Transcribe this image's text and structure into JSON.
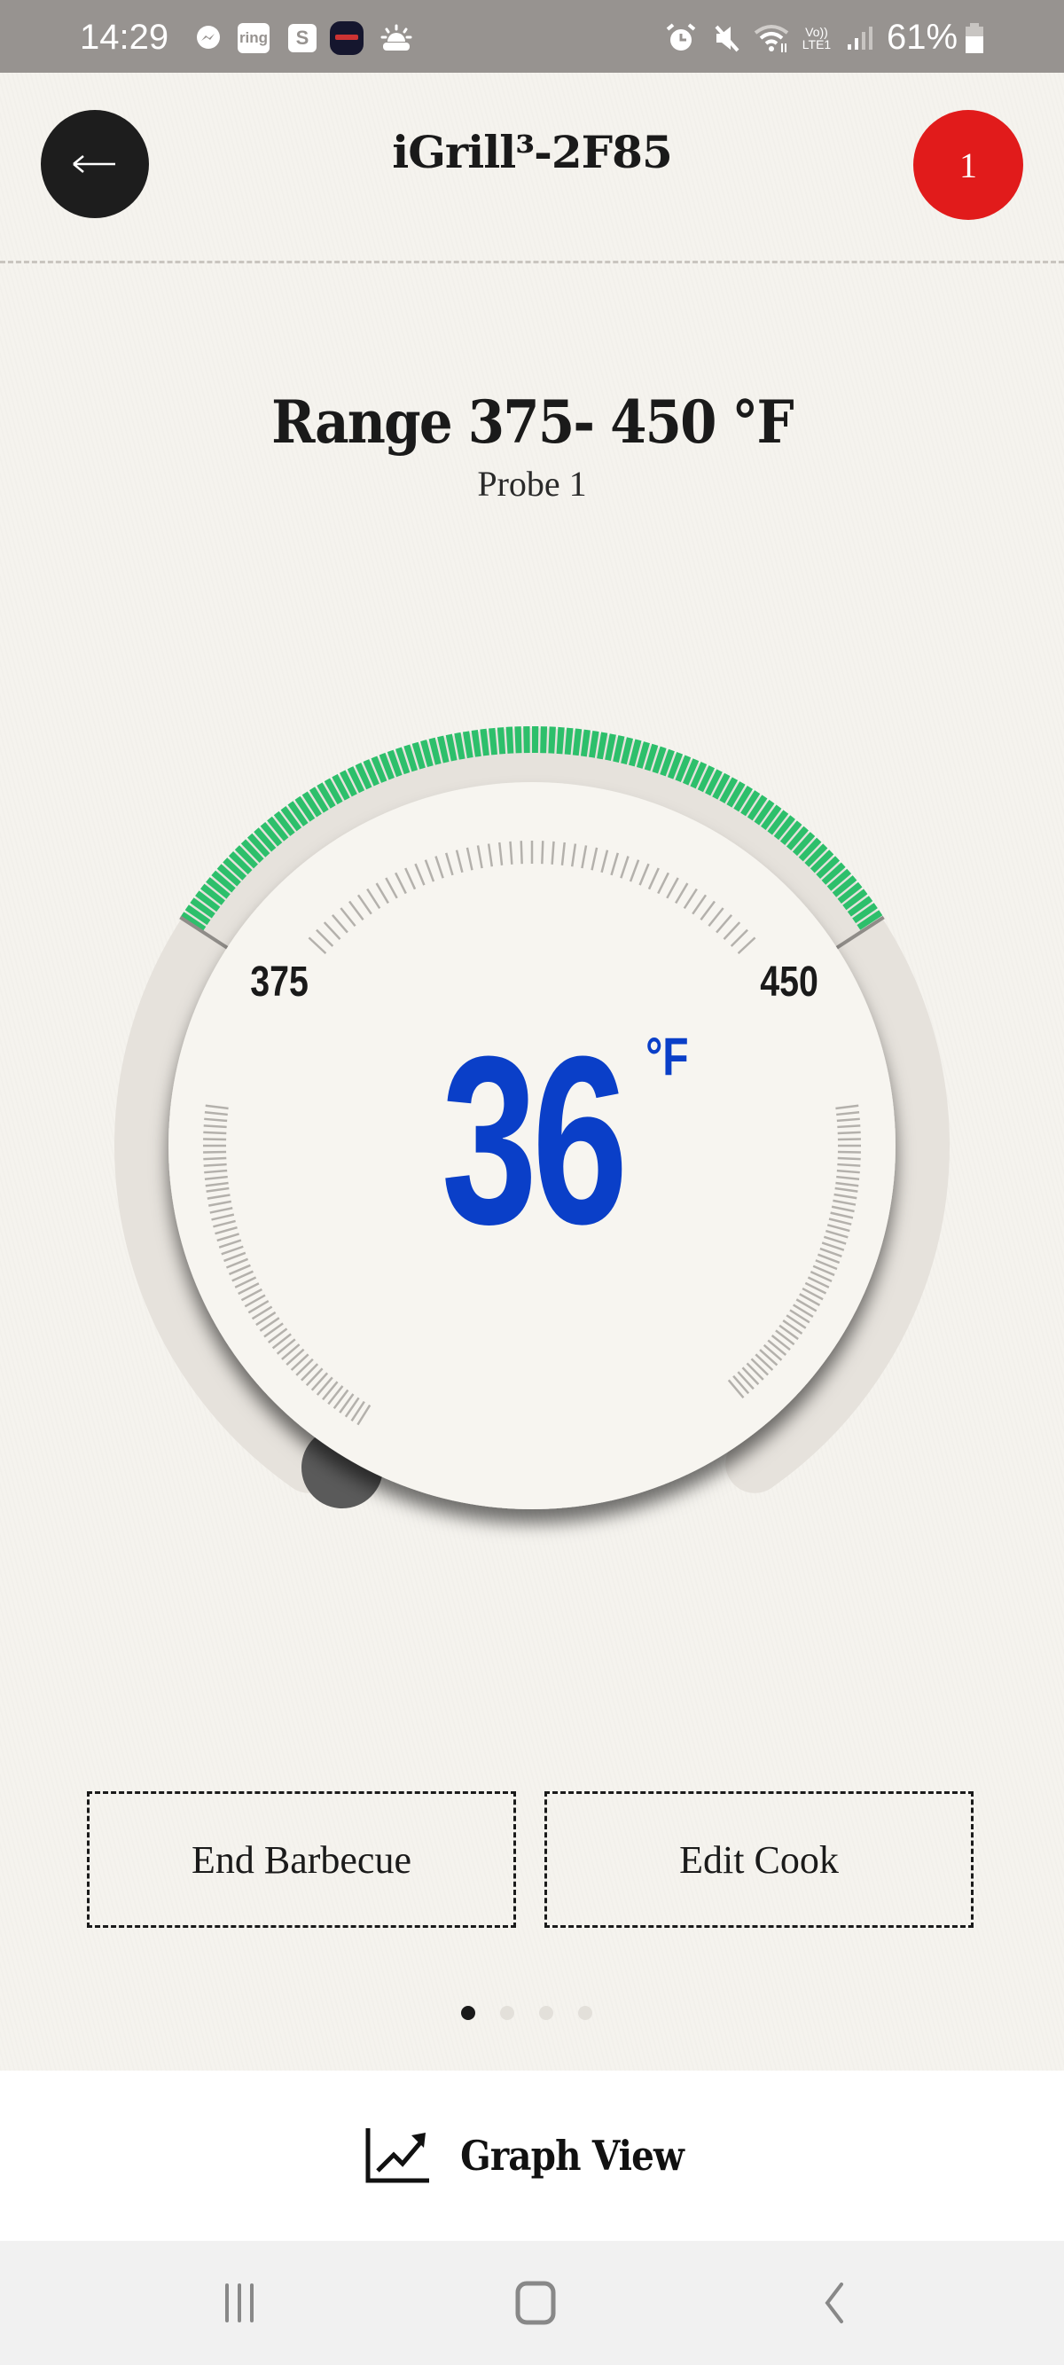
{
  "status_bar": {
    "time": "14:29",
    "left_icons": [
      "messenger-icon",
      "ring-icon",
      "s-app-icon",
      "app-badge-icon",
      "weather-sunrise-icon"
    ],
    "ring_label": "ring",
    "s_label": "S",
    "right_icons": [
      "alarm-icon",
      "mute-icon",
      "wifi-icon",
      "volte-lte-icon",
      "signal-icon",
      "battery-icon"
    ],
    "volte_label": "Vo)) LTE1",
    "battery_percent": "61%"
  },
  "header": {
    "back_icon": "arrow-left-icon",
    "title": "iGrill³-2F85",
    "notification_count": "1"
  },
  "range": {
    "title": "Range 375- 450 °F",
    "probe": "Probe 1"
  },
  "gauge": {
    "current_value": "36",
    "unit": "°F",
    "range_low_label": "375",
    "range_high_label": "450",
    "target_low": 375,
    "target_high": 450,
    "current_temp": 36,
    "colors": {
      "target_arc": "#2dbf6b",
      "reading": "#0a3fc8",
      "indicator": "#5a5a5a"
    }
  },
  "actions": {
    "end_label": "End Barbecue",
    "edit_label": "Edit Cook"
  },
  "pager": {
    "count": 4,
    "active_index": 0
  },
  "bottom_bar": {
    "icon": "graph-trend-icon",
    "label": "Graph View"
  },
  "nav": {
    "recents": "recents-icon",
    "home": "home-icon",
    "back": "back-icon"
  }
}
